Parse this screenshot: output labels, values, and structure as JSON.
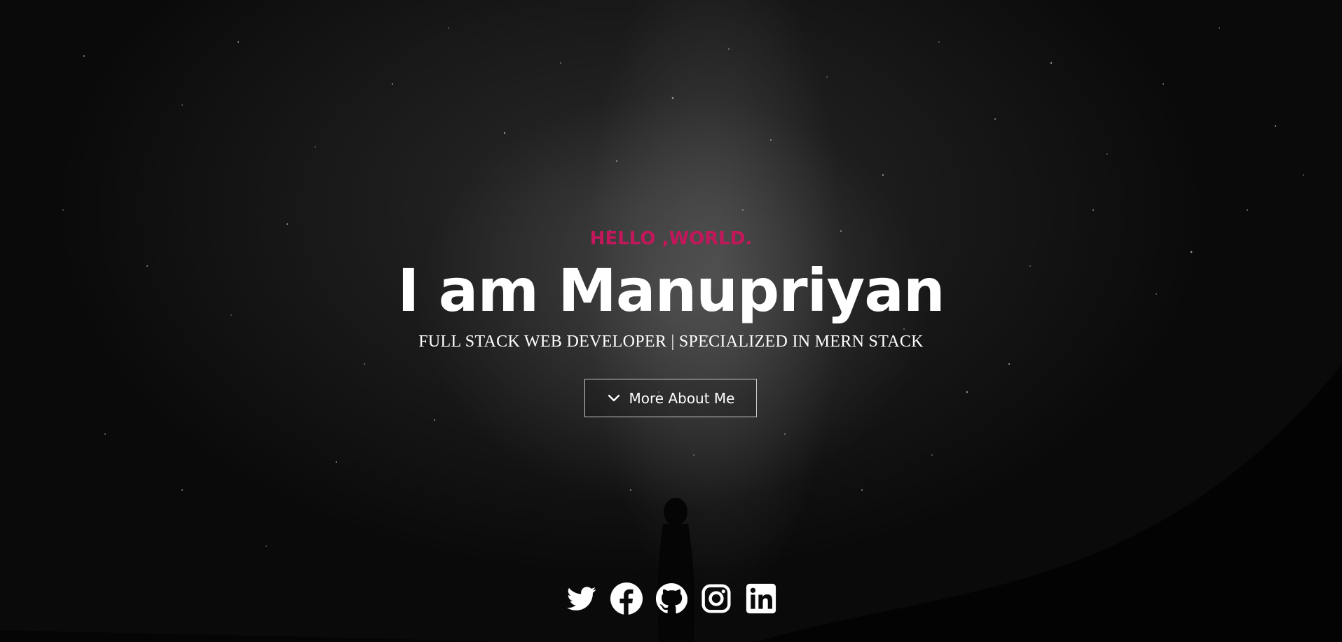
{
  "hero": {
    "kicker": "HELLO ,WORLD.",
    "headline": "I am Manupriyan",
    "subtitle": "FULL STACK WEB DEVELOPER | SPECIALIZED IN MERN STACK",
    "cta_label": "More About Me",
    "cta_icon": "chevron-down-icon"
  },
  "socials": [
    {
      "icon": "twitter-icon"
    },
    {
      "icon": "facebook-icon"
    },
    {
      "icon": "github-icon"
    },
    {
      "icon": "instagram-icon"
    },
    {
      "icon": "linkedin-icon"
    }
  ],
  "colors": {
    "accent": "#c2185b",
    "text": "#ffffff",
    "background": "#0a0a0a"
  }
}
